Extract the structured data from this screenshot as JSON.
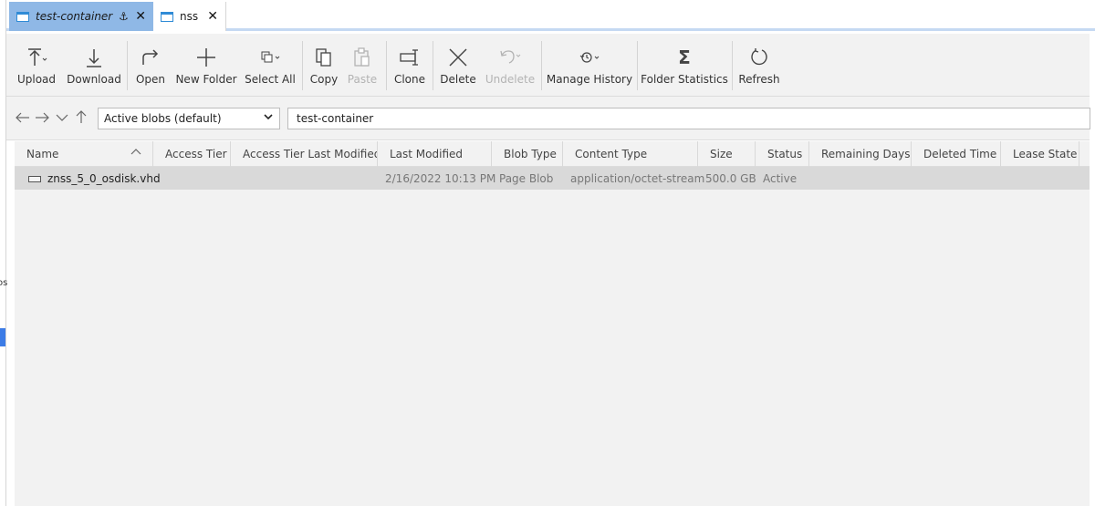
{
  "left_strip": {
    "fragment": "os"
  },
  "tabs": [
    {
      "label": "test-container",
      "active": true
    },
    {
      "label": "nss",
      "active": false
    }
  ],
  "toolbar": {
    "upload": "Upload",
    "download": "Download",
    "open": "Open",
    "new_folder": "New Folder",
    "select_all": "Select All",
    "copy": "Copy",
    "paste": "Paste",
    "clone": "Clone",
    "delete": "Delete",
    "undelete": "Undelete",
    "manage_history": "Manage History",
    "folder_statistics": "Folder Statistics",
    "refresh": "Refresh"
  },
  "nav": {
    "view_select": "Active blobs (default)",
    "path": "test-container"
  },
  "table": {
    "columns": [
      "Name",
      "Access Tier",
      "Access Tier Last Modified",
      "Last Modified",
      "Blob Type",
      "Content Type",
      "Size",
      "Status",
      "Remaining Days",
      "Deleted Time",
      "Lease State"
    ],
    "rows": [
      {
        "name": "znss_5_0_osdisk.vhd",
        "access_tier": "",
        "access_tier_last_modified": "",
        "last_modified": "2/16/2022 10:13 PM",
        "blob_type": "Page Blob",
        "content_type": "application/octet-stream",
        "size": "500.0 GB",
        "status": "Active",
        "remaining_days": "",
        "deleted_time": "",
        "lease_state": ""
      }
    ]
  }
}
